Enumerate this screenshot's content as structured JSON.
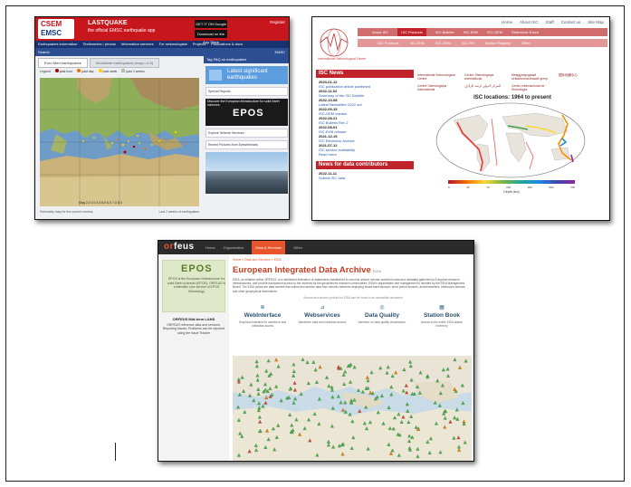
{
  "emsc": {
    "logo_line1": "CSEM",
    "logo_line2": "EMSC",
    "app_title": "LASTQUAKE",
    "app_subtitle": "the official EMSC earthquake app",
    "google_play": "GET IT ON Google Play",
    "app_store": "Download on the App Store",
    "login": "Register",
    "nav": [
      "Earthquakes information",
      "Testimonies / photos",
      "Information services",
      "For seismologists",
      "Projects",
      "Publications & docs"
    ],
    "sub_left": "Search",
    "sub_right": "EMSC",
    "tabs": [
      "Euro-Med earthquakes",
      "Worldwide earthquakes (mag>=4.5)"
    ],
    "legend": [
      "Legend",
      "past hour",
      "past day",
      "past week",
      "past 2 weeks"
    ],
    "mag_label": "Mag",
    "mag_values": [
      "2.0",
      "3.0",
      "4.0",
      "5.0",
      "6.0",
      "7.0",
      "8.0"
    ],
    "bottom_left": "Seismicity map for the current century",
    "bottom_right": "Last 2 weeks of earthquakes",
    "side_header": "Tag",
    "side_header2": "FAQ on earthquakes",
    "latest": "Latest significant earthquakes",
    "special_reports": "Special Reports",
    "epos_caption": "Discover the European infrastructure for solid Earth sciences",
    "epos_logo": "EPOS",
    "explore": "Explore Seismic Services",
    "photos": "Recent Pictures from Eyewitnesses"
  },
  "isc": {
    "logo_text": "International Seismological Centre",
    "topnav": [
      "Home",
      "About ISC",
      "Staff",
      "Contact us",
      "Site Map"
    ],
    "menu1": [
      "About ISC",
      "ISC Products",
      "ISC Bulletin",
      "ISC-EHB",
      "ISC-GEM",
      "Reference Event"
    ],
    "menu2": [
      "ISC Products",
      "ISC-EHB",
      "ISC-GEM",
      "ISC-FM",
      "Station Registry",
      "Other"
    ],
    "news_title": "ISC News",
    "news": [
      {
        "date": "2023-01-12",
        "text": "ISC publication article published"
      },
      {
        "date": "2022-11-02",
        "text": "Summary of the ISC Bulletin"
      },
      {
        "date": "2022-10-08",
        "text": "Latest Newsletter 2022 out"
      },
      {
        "date": "2022-09-15",
        "text": "ISC-GEM release"
      },
      {
        "date": "2022-08-21",
        "text": "ISC Bulletin Rev 2"
      },
      {
        "date": "2022-08-01",
        "text": "ISC-EHB release"
      },
      {
        "date": "2021-12-15",
        "text": "ISC Electronic Archive"
      },
      {
        "date": "2021-07-12",
        "text": "ISC service availability"
      }
    ],
    "news_more": "Read more",
    "contrib_title": "News for data contributors",
    "contrib": [
      {
        "date": "2022-11-11",
        "text": "Submit ISC data"
      }
    ],
    "partners": [
      "International Seismological Centre",
      "Centre Sismologique International",
      "Международный сейсмологический центр",
      "国际地震中心",
      "Centre Sismologique International",
      "المركز الدولي لرصد الزلازل",
      "Centro Internacional de Sismología"
    ],
    "map_title": "ISC locations: 1964 to present",
    "depth_ticks": [
      "0",
      "35",
      "70",
      "150",
      "300",
      "500",
      "700"
    ],
    "depth_label": "Depth (km)"
  },
  "orfeus": {
    "logo_part1": "or",
    "logo_part2": "feus",
    "nav": [
      "Home",
      "Organization",
      "Data & Services",
      "Other"
    ],
    "nav_active_index": 2,
    "breadcrumb": "Home » Data and Services » EIDA",
    "title": "European Integrated Data Archive",
    "title_tag": "EIDA",
    "intro": "EIDA, an initiative within ORFEUS, is a distributed federation of datacentres established to securely archive seismic waveform data and metadata gathered by European research infrastructures, and provide transparent access to the archives by the geosciences research communities. EIDA's organization and management is handled by the EIDA Management Board. The EIDA nodes are data centres that collect and archive data from seismic networks deploying broad-band sensors, short period sensors, accelerometers, infrasound sensors and other geophysical instruments.",
    "note": "Access and service policies for EIDA can be found in an accessible document",
    "cards": [
      {
        "icon": "⊕",
        "title": "WebInterface",
        "text": "Graphical interface for waveform and metadata access"
      },
      {
        "icon": "⊿",
        "title": "Webservices",
        "text": "Waveform data and metadata access"
      },
      {
        "icon": "◎",
        "title": "Data Quality",
        "text": "Interface for data quality visualization"
      },
      {
        "icon": "▦",
        "title": "Station Book",
        "text": "Access to the entire EIDA station inventory"
      }
    ],
    "side_epos_logo": "EPOS",
    "side_epos_text": "EPOS is the European Infrastructure for solid Earth sciences (EPOS). ORFEUS is a thematic core service of EPOS Seismology",
    "side_s2_title": "ORFEUS Mid-term LANS",
    "side_s2_text": "ORFEUS reference data and services. Reporting Issues: Problems can be reported using the Issue Tracker"
  }
}
